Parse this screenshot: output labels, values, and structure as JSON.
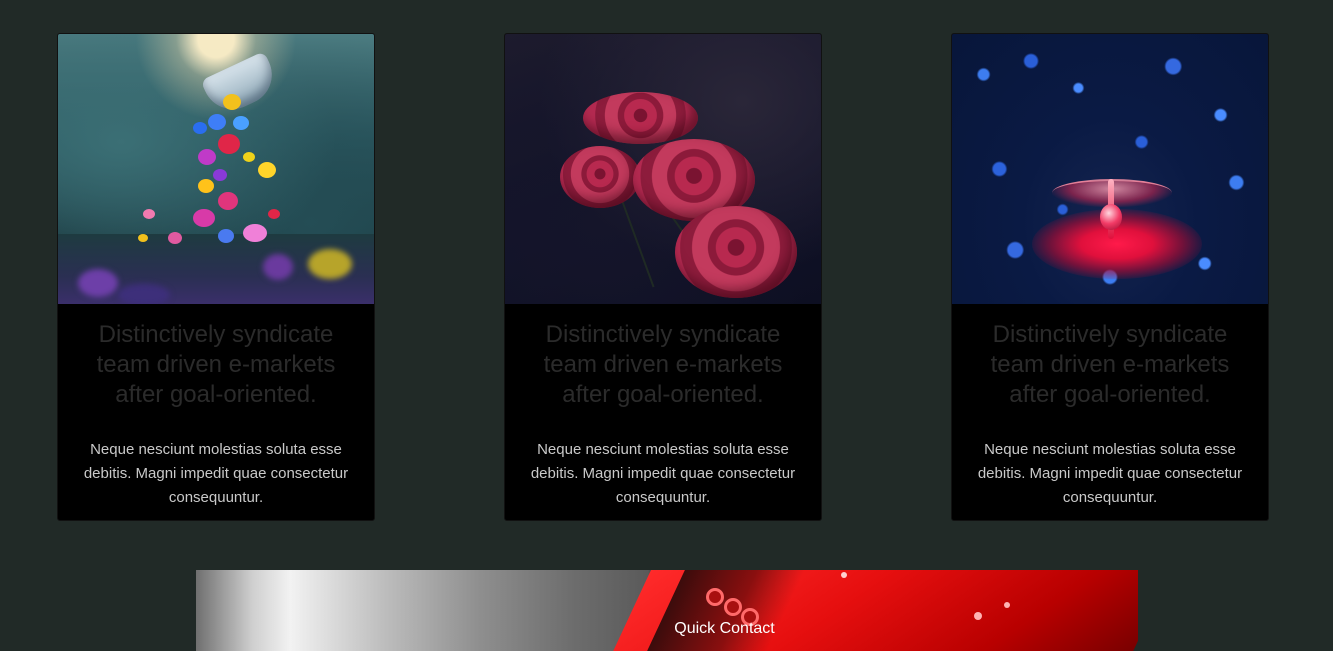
{
  "cards": [
    {
      "image_alt": "teacup pouring flowers",
      "title": "Distinctively syndicate team driven e-markets after goal-oriented.",
      "text": "Neque nesciunt molestias soluta esse debitis. Magni impedit quae consectetur consequuntur."
    },
    {
      "image_alt": "red roses",
      "title": "Distinctively syndicate team driven e-markets after goal-oriented.",
      "text": "Neque nesciunt molestias soluta esse debitis. Magni impedit quae consectetur consequuntur."
    },
    {
      "image_alt": "red water drop",
      "title": "Distinctively syndicate team driven e-markets after goal-oriented.",
      "text": "Neque nesciunt molestias soluta esse debitis. Magni impedit quae consectetur consequuntur."
    }
  ],
  "banner": {
    "label": "Quick Contact"
  },
  "colors": {
    "page_background": "#212a27",
    "card_background": "#000000",
    "card_title": "#2b2b2b",
    "card_text": "#c9c9c9",
    "banner_text": "#ffffff"
  }
}
